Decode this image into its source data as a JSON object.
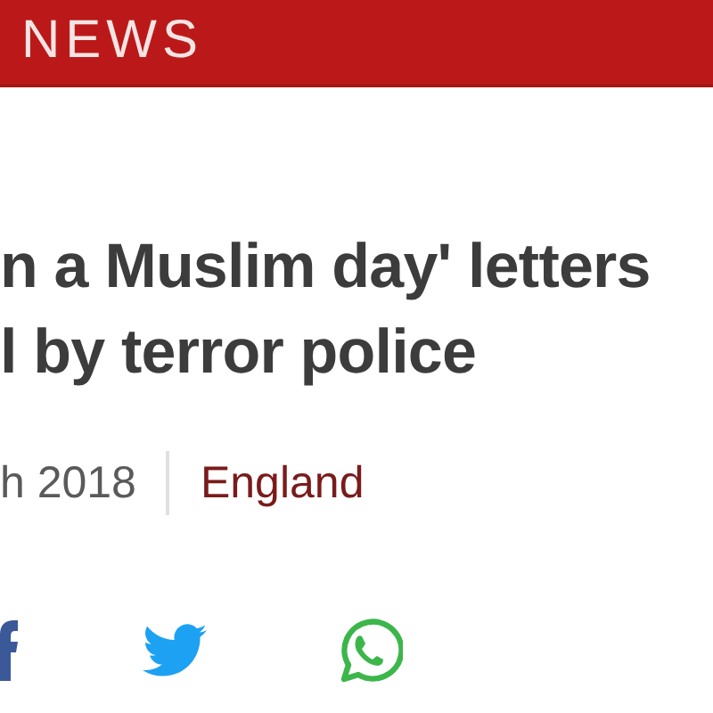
{
  "header": {
    "brand": "NEWS"
  },
  "headline": {
    "lines": [
      "n a Muslim day' letters",
      "l by terror police"
    ]
  },
  "byline": {
    "date": "h 2018",
    "section": "England"
  },
  "share": [
    {
      "kind": "facebook"
    },
    {
      "kind": "twitter"
    },
    {
      "kind": "whatsapp"
    }
  ]
}
